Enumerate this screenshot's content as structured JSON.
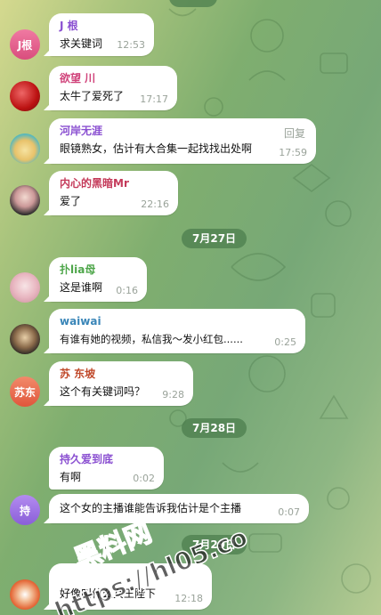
{
  "colors": {
    "name_purple": "#8a4fd1",
    "name_pink": "#d0427a",
    "name_red": "#c43a5a",
    "name_green": "#4ea64a",
    "name_blue": "#3a86b8",
    "name_brown": "#c0492a"
  },
  "messages": [
    {
      "name": "J 根",
      "avatar_text": "J根",
      "text": "求关键词",
      "time": "12:53"
    },
    {
      "name": "欲望 川",
      "avatar_text": "",
      "text": "太牛了爱死了",
      "time": "17:17"
    },
    {
      "name": "河岸无涯",
      "avatar_text": "",
      "text": "眼镜熟女，估计有大合集一起找找出处啊",
      "time": "17:59",
      "reply_label": "回复"
    },
    {
      "name": "内心的黑暗Mr",
      "avatar_text": "",
      "text": "爱了",
      "time": "22:16"
    },
    {
      "name": "扑lia母",
      "avatar_text": "",
      "text": "这是谁啊",
      "time": "0:16"
    },
    {
      "name": "waiwai",
      "avatar_text": "",
      "text": "有谁有她的视频，私信我～发小红包......",
      "time": "0:25"
    },
    {
      "name": "苏 东坡",
      "avatar_text": "苏东",
      "text": "这个有关键词吗？",
      "time": "9:28"
    },
    {
      "name": "持久爱到底",
      "avatar_text": "",
      "text": "有啊",
      "time": "0:02"
    },
    {
      "name": "",
      "avatar_text": "持",
      "text": "这个女的主播谁能告诉我估计是个主播",
      "time": "0:07"
    },
    {
      "name": "",
      "avatar_text": "",
      "text": "好像叫什么女王陛下",
      "time": "12:18"
    }
  ],
  "dates": [
    "7月27日",
    "7月28日",
    "7月29日"
  ],
  "watermark": {
    "line1": "黑料网",
    "line2": "https://hl05.co"
  }
}
